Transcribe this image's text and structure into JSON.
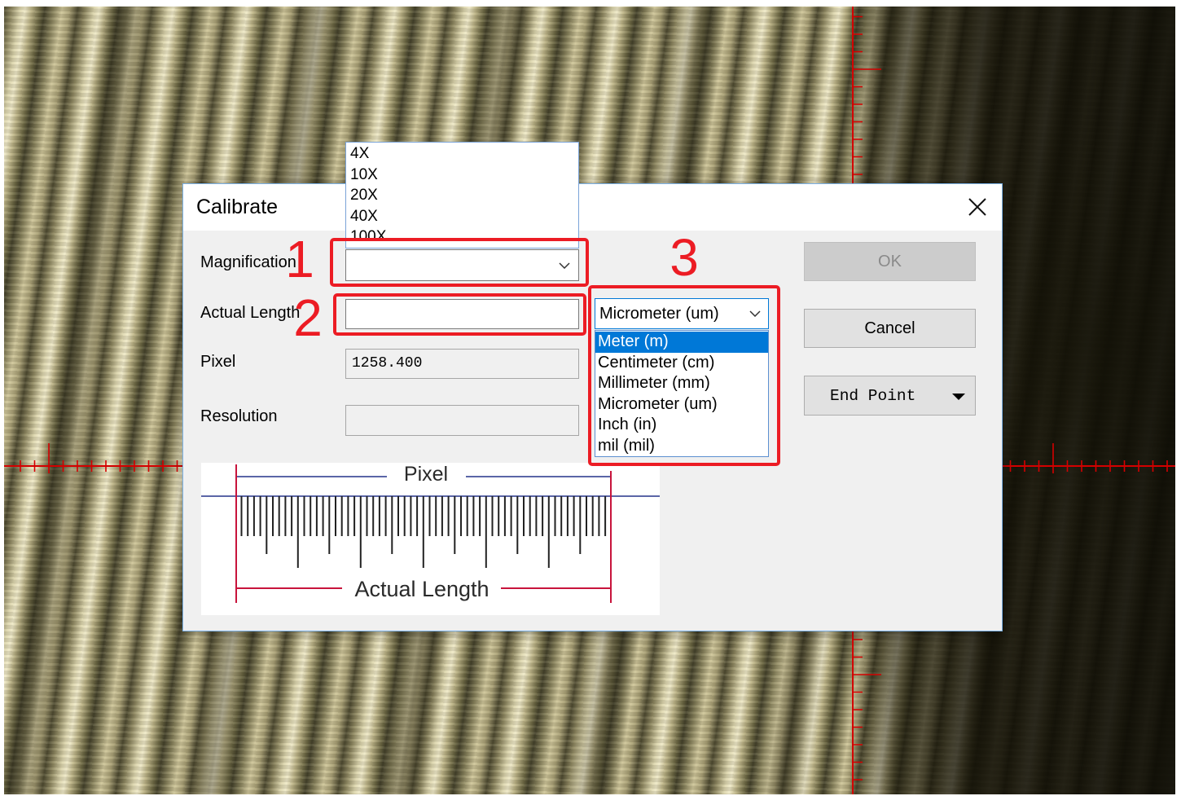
{
  "dialog": {
    "title": "Calibrate"
  },
  "labels": {
    "magnification": "Magnification",
    "actual_length": "Actual Length",
    "pixel": "Pixel",
    "resolution": "Resolution"
  },
  "fields": {
    "pixel_value": "1258.400"
  },
  "magnification_dropdown": {
    "options": [
      "4X",
      "10X",
      "20X",
      "40X",
      "100X"
    ]
  },
  "unit_dropdown": {
    "selected": "Micrometer (um)",
    "highlighted_index": 0,
    "options": [
      "Meter (m)",
      "Centimeter (cm)",
      "Millimeter (mm)",
      "Micrometer (um)",
      "Inch (in)",
      "mil (mil)"
    ]
  },
  "buttons": {
    "ok": "OK",
    "ok_enabled": false,
    "cancel": "Cancel",
    "end_point": "End Point"
  },
  "illustration": {
    "pixel_label": "Pixel",
    "actual_length_label": "Actual Length"
  },
  "annotations": {
    "step_1": "1",
    "step_2": "2",
    "step_3": "3"
  },
  "icons": {
    "close": "close-icon",
    "combo_arrow": "chevron-down-icon",
    "split_button_arrow": "caret-down-icon"
  },
  "colors": {
    "accent": "#0078d7",
    "annotation_red": "#ec1c24",
    "crosshair_red": "#d40000",
    "dialog_background": "#f0f0f0"
  }
}
